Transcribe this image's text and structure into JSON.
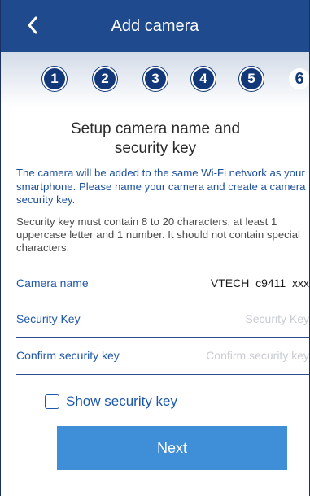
{
  "header": {
    "title": "Add camera"
  },
  "steps": [
    "1",
    "2",
    "3",
    "4",
    "5",
    "6"
  ],
  "current_step": 6,
  "title": {
    "line1": "Setup camera name and",
    "line2": "security key"
  },
  "info_text": "The camera will be added to the same Wi-Fi network as your smartphone. Please name your camera and create a camera security key.",
  "rules_text": "Security key must contain 8 to 20 characters, at least 1 uppercase letter and 1 number. It should not contain special characters.",
  "fields": {
    "camera_name": {
      "label": "Camera name",
      "value": "VTECH_c9411_xxx"
    },
    "security_key": {
      "label": "Security Key",
      "placeholder": "Security Key"
    },
    "confirm_key": {
      "label": "Confirm security key",
      "placeholder": "Confirm security key"
    }
  },
  "show_key": {
    "label": "Show security key",
    "checked": false
  },
  "next_button": {
    "label": "Next"
  },
  "colors": {
    "header_bg": "#1f4b8e",
    "step_bg": "#12387a",
    "accent_text": "#1f58a8",
    "button_bg": "#3f8fd8"
  }
}
